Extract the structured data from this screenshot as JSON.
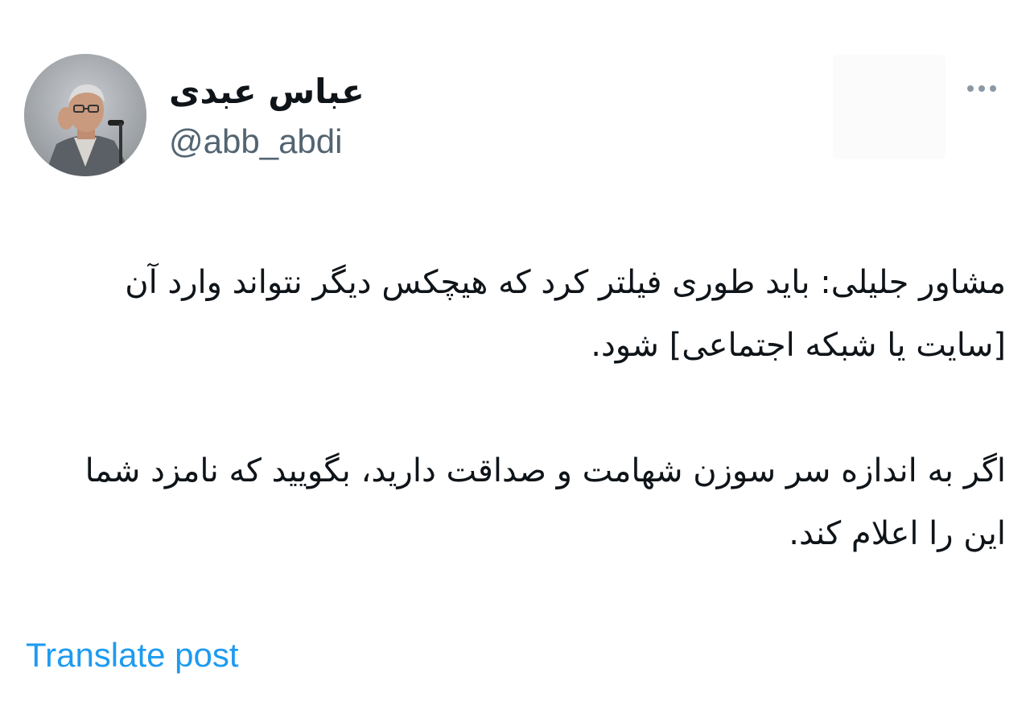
{
  "author": {
    "display_name": "عباس عبدی",
    "handle": "@abb_abdi"
  },
  "post": {
    "paragraph_1": "مشاور جلیلی: باید طوری فیلتر کرد که هیچکس دیگر نتواند وارد آن [سایت یا شبکه اجتماعی] شود.",
    "paragraph_2": "اگر به اندازه سر سوزن شهامت و صداقت دارید، بگویید که نامزد شما این را اعلام کند."
  },
  "actions": {
    "translate_label": "Translate post",
    "more_icon": "more-horizontal-icon"
  },
  "colors": {
    "link": "#1d9bf0",
    "secondary_text": "#536471",
    "primary_text": "#0f1419"
  }
}
